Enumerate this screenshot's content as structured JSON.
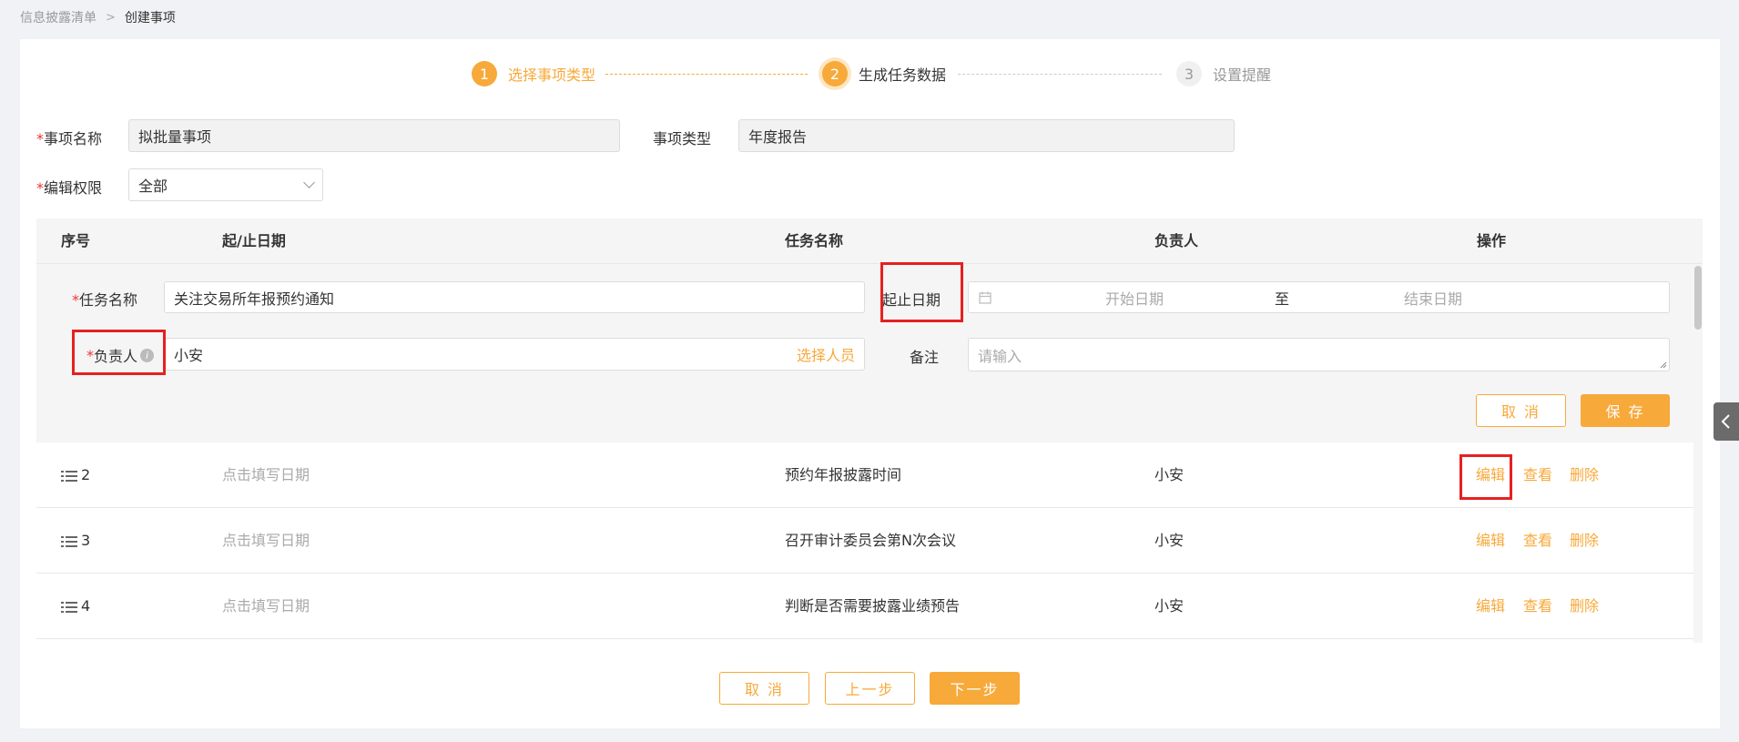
{
  "breadcrumb": {
    "parent": "信息披露清单",
    "current": "创建事项"
  },
  "steps": [
    {
      "num": "1",
      "label": "选择事项类型"
    },
    {
      "num": "2",
      "label": "生成任务数据"
    },
    {
      "num": "3",
      "label": "设置提醒"
    }
  ],
  "form": {
    "name_label": "事项名称",
    "name_value": "拟批量事项",
    "type_label": "事项类型",
    "type_value": "年度报告",
    "perm_label": "编辑权限",
    "perm_value": "全部",
    "required_mark": "*"
  },
  "table": {
    "headers": [
      "序号",
      "起/止日期",
      "任务名称",
      "负责人",
      "操作"
    ]
  },
  "edit": {
    "task_label": "任务名称",
    "task_value": "关注交易所年报预约通知",
    "date_label": "起止日期",
    "start_placeholder": "开始日期",
    "range_sep": "至",
    "end_placeholder": "结束日期",
    "owner_label": "负责人",
    "owner_value": "小安",
    "select_person": "选择人员",
    "note_label": "备注",
    "note_placeholder": "请输入",
    "cancel": "取 消",
    "save": "保 存"
  },
  "rows": [
    {
      "index": "2",
      "date": "点击填写日期",
      "task": "预约年报披露时间",
      "owner": "小安"
    },
    {
      "index": "3",
      "date": "点击填写日期",
      "task": "召开审计委员会第N次会议",
      "owner": "小安"
    },
    {
      "index": "4",
      "date": "点击填写日期",
      "task": "判断是否需要披露业绩预告",
      "owner": "小安"
    }
  ],
  "actions": {
    "edit": "编辑",
    "view": "查看",
    "delete": "删除"
  },
  "footer": {
    "cancel": "取 消",
    "prev": "上一步",
    "next": "下一步"
  },
  "colors": {
    "accent": "#f7a93a",
    "highlight": "#e52121"
  }
}
